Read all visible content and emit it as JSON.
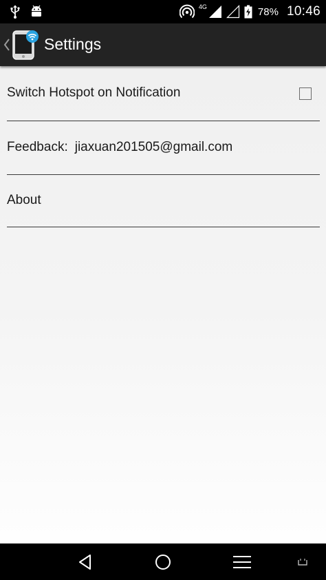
{
  "status_bar": {
    "network_type": "4G",
    "battery_percent": "78%",
    "time": "10:46"
  },
  "action_bar": {
    "title": "Settings"
  },
  "settings": {
    "hotspot_notification_label": "Switch Hotspot on Notification",
    "hotspot_notification_checked": false,
    "feedback_label": "Feedback:",
    "feedback_email": "jiaxuan201505@gmail.com",
    "about_label": "About"
  },
  "colors": {
    "action_bar_bg": "#232323",
    "content_bg": "#f2f2f2",
    "divider": "#3a3a3a",
    "text": "#1a1a1a",
    "app_icon_accent": "#2aa3e0"
  }
}
